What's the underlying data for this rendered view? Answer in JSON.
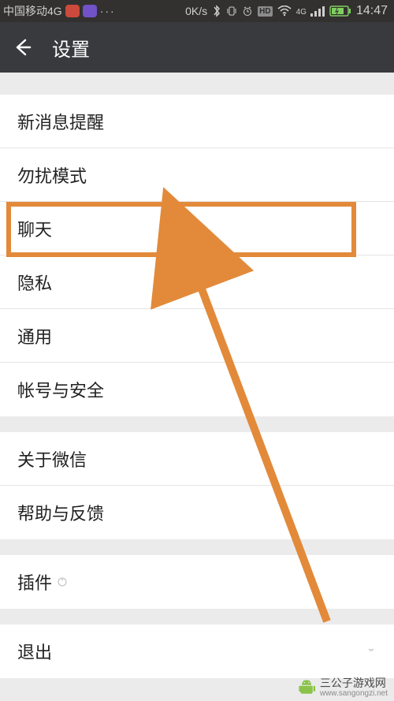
{
  "status": {
    "carrier": "中国移动4G",
    "speed": "0K/s",
    "hd": "HD",
    "net_label": "4G",
    "time": "14:47"
  },
  "header": {
    "title": "设置"
  },
  "groups": {
    "g1": {
      "r0": "新消息提醒",
      "r1": "勿扰模式",
      "r2": "聊天",
      "r3": "隐私",
      "r4": "通用",
      "r5": "帐号与安全"
    },
    "g2": {
      "r0": "关于微信",
      "r1": "帮助与反馈"
    },
    "g3": {
      "r0": "插件"
    },
    "g4": {
      "r0": "退出"
    }
  },
  "watermark": {
    "title": "三公子游戏网",
    "url": "www.sangongzi.net"
  },
  "colors": {
    "highlight": "#e28a3a"
  }
}
